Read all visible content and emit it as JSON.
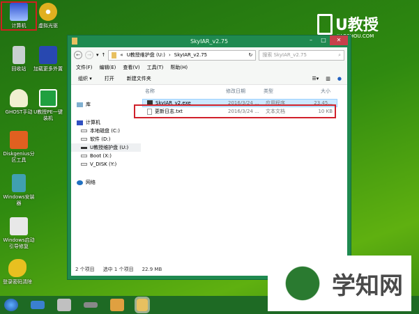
{
  "desktop": {
    "icons": [
      {
        "label": "计算机",
        "selected": true
      },
      {
        "label": "虚拟光驱"
      },
      {
        "label": "回收站"
      },
      {
        "label": "加载更多外置"
      },
      {
        "label": "GHOST手动"
      },
      {
        "label": "U教授PE一键装机"
      },
      {
        "label": "Diskgenius分区工具"
      },
      {
        "label": "Windows安装器"
      },
      {
        "label": "Windows启动引导修复"
      },
      {
        "label": "登录密码清除"
      }
    ]
  },
  "logo": {
    "brand": "U教授",
    "site": "JIAOSHOU.COM"
  },
  "window": {
    "title": "SkyIAR_v2.75",
    "address": {
      "prefix": "«",
      "drive": "U教授维护盘 (U:)",
      "sep": "›",
      "folder": "SkyIAR_v2.75",
      "search_placeholder": "搜索 SkyIAR_v2.75"
    },
    "menu": [
      "文件(F)",
      "编辑(E)",
      "查看(V)",
      "工具(T)",
      "帮助(H)"
    ],
    "toolbar": {
      "organize": "组织 ▾",
      "open": "打开",
      "new_folder": "新建文件夹"
    },
    "nav": {
      "library": "库",
      "computer": "计算机",
      "drives": [
        "本地磁盘 (C:)",
        "软件 (D:)",
        "U教授维护盘 (U:)",
        "Boot (X:)",
        "V_DISK (Y:)"
      ],
      "network": "网络"
    },
    "columns": [
      "名称",
      "修改日期",
      "类型",
      "大小"
    ],
    "files": [
      {
        "name": "SkyIAR_v2.exe",
        "date": "2016/3/24 ...",
        "type": "应用程序",
        "size": "23,45..."
      },
      {
        "name": "更新日志.txt",
        "date": "2016/3/24 ...",
        "type": "文本文档",
        "size": "10 KB"
      }
    ],
    "status": {
      "count": "2 个项目",
      "selected": "选中 1 个项目",
      "size": "22.9 MB"
    }
  },
  "watermark": "学知网"
}
